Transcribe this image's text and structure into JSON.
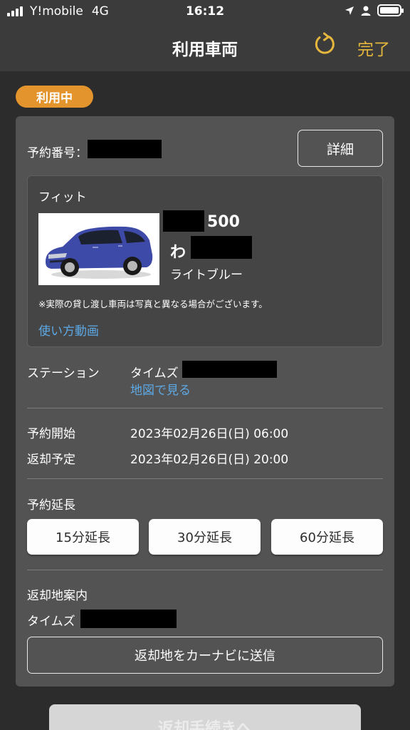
{
  "status_bar": {
    "carrier": "Y!mobile",
    "network": "4G",
    "time": "16:12"
  },
  "nav": {
    "title": "利用車両",
    "done_label": "完了",
    "refresh_icon": "refresh-icon"
  },
  "colors": {
    "background": "#2c2c2c",
    "panel": "#535353",
    "accent_gold": "#e6b73d",
    "badge_orange": "#e3942c",
    "link_blue": "#5da9e6"
  },
  "badge": "利用中",
  "reservation": {
    "number_label": "予約番号：",
    "detail_button": "詳細"
  },
  "car": {
    "model": "フィット",
    "plate_number": "500",
    "plate_kana": "わ",
    "color": "ライトブルー",
    "note": "※実際の貸し渡し車両は写真と異なる場合がございます。",
    "video_link": "使い方動画"
  },
  "station": {
    "label": "ステーション",
    "name_prefix": "タイムズ",
    "map_link": "地図で見る"
  },
  "schedule": {
    "start_label": "予約開始",
    "start_value": "2023年02月26日(日) 06:00",
    "end_label": "返却予定",
    "end_value": "2023年02月26日(日) 20:00"
  },
  "extension": {
    "label": "予約延長",
    "buttons": [
      "15分延長",
      "30分延長",
      "60分延長"
    ]
  },
  "return_info": {
    "label": "返却地案内",
    "place_prefix": "タイムズ",
    "navi_button": "返却地をカーナビに送信"
  },
  "bottom_button": "返却手続きへ"
}
